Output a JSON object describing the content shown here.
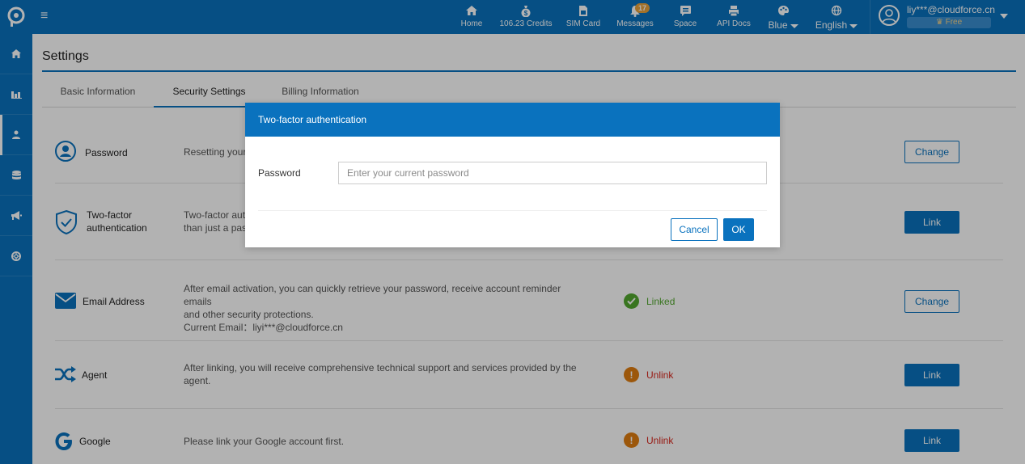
{
  "topbar": {
    "nav": [
      {
        "label": "Home",
        "icon": "home-icon"
      },
      {
        "label": "106.23 Credits",
        "icon": "money-bag-icon"
      },
      {
        "label": "SIM Card",
        "icon": "sim-card-icon"
      },
      {
        "label": "Messages",
        "icon": "bell-icon",
        "badge": "17"
      },
      {
        "label": "Space",
        "icon": "chat-icon"
      },
      {
        "label": "API Docs",
        "icon": "printer-icon"
      }
    ],
    "theme": "Blue",
    "language": "English",
    "user_email": "liy***@cloudforce.cn",
    "plan": "Free"
  },
  "sidebar": {
    "items": [
      {
        "icon": "home-icon"
      },
      {
        "icon": "chart-icon"
      },
      {
        "icon": "user-icon",
        "active": true
      },
      {
        "icon": "database-icon"
      },
      {
        "icon": "megaphone-icon"
      },
      {
        "icon": "lifebuoy-icon"
      }
    ]
  },
  "page": {
    "title": "Settings",
    "tabs": [
      "Basic Information",
      "Security Settings",
      "Billing Information"
    ],
    "active_tab": "Security Settings"
  },
  "security": {
    "rows": [
      {
        "name": "Password",
        "desc": "Resetting your",
        "status": "",
        "button": "Change"
      },
      {
        "name_line1": "Two-factor",
        "name_line2": "authentication",
        "desc_line1": "Two-factor aut",
        "desc_line2": "than just a pas",
        "status": "",
        "button": "Link"
      },
      {
        "name": "Email Address",
        "desc_line1": "After email activation, you can quickly retrieve your password, receive account reminder emails",
        "desc_line2": "and other security protections.",
        "desc_line3": "Current Email：liyi***@cloudforce.cn",
        "status": "Linked",
        "button": "Change"
      },
      {
        "name": "Agent",
        "desc_line1": "After linking, you will receive comprehensive technical support and services provided by the",
        "desc_line2": "agent.",
        "status": "Unlink",
        "button": "Link"
      },
      {
        "name": "Google",
        "desc": "Please link your Google account first.",
        "status": "Unlink",
        "button": "Link"
      }
    ]
  },
  "modal": {
    "title": "Two-factor authentication",
    "password_label": "Password",
    "password_placeholder": "Enter your current password",
    "cancel_label": "Cancel",
    "ok_label": "OK"
  },
  "colors": {
    "primary": "#0a72be",
    "linked": "#52a82e",
    "unlink": "#d9261c",
    "warning": "#e07d10"
  }
}
